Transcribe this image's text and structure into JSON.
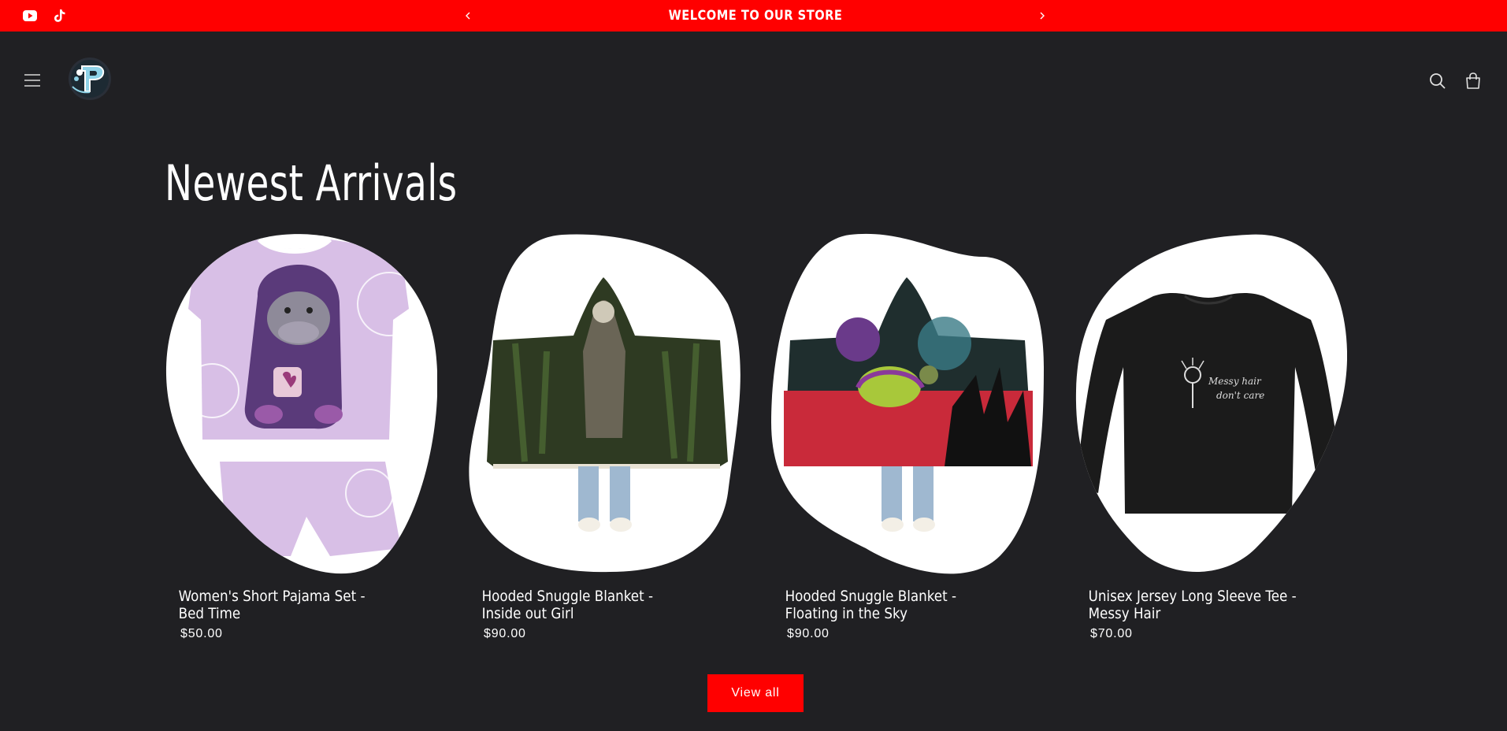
{
  "announcement": {
    "message": "WELCOME TO OUR STORE",
    "background": "#ff0000"
  },
  "social": {
    "youtube_icon": "youtube-icon",
    "tiktok_icon": "tiktok-icon"
  },
  "header": {
    "menu_icon": "hamburger-menu-icon",
    "logo_icon": "store-logo",
    "search_icon": "search-icon",
    "cart_icon": "cart-icon"
  },
  "section": {
    "title": "Newest Arrivals",
    "view_all_label": "View all"
  },
  "products": [
    {
      "title": "Women's Short Pajama Set - Bed Time",
      "price": "$50.00"
    },
    {
      "title": "Hooded Snuggle Blanket - Inside out Girl",
      "price": "$90.00"
    },
    {
      "title": "Hooded Snuggle Blanket - Floating in the Sky",
      "price": "$90.00"
    },
    {
      "title": "Unisex Jersey Long Sleeve Tee - Messy Hair",
      "price": "$70.00"
    }
  ],
  "colors": {
    "page_background": "#202023",
    "accent": "#ff0000",
    "text": "#ffffff"
  }
}
